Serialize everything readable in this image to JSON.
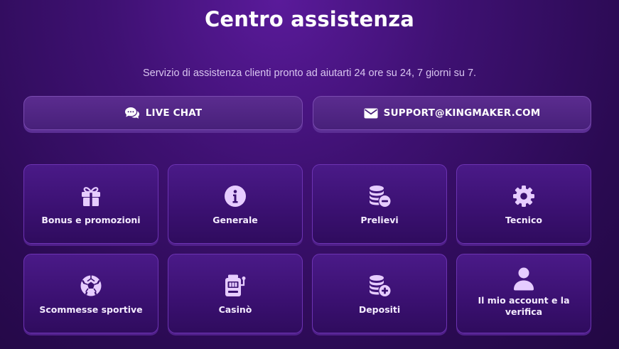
{
  "header": {
    "title": "Centro assistenza",
    "subtitle": "Servizio di assistenza clienti pronto ad aiutarti 24 ore su 24, 7 giorni su 7."
  },
  "contact": {
    "chat_label": "LIVE CHAT",
    "chat_icon": "chat-bubbles-icon",
    "email_label": "SUPPORT@KINGMAKER.COM",
    "email_icon": "envelope-icon"
  },
  "categories": [
    {
      "label": "Bonus e promozioni",
      "icon": "gift-icon"
    },
    {
      "label": "Generale",
      "icon": "info-icon"
    },
    {
      "label": "Prelievi",
      "icon": "coins-minus-icon"
    },
    {
      "label": "Tecnico",
      "icon": "gear-icon"
    },
    {
      "label": "Scommesse sportive",
      "icon": "soccer-ball-icon"
    },
    {
      "label": "Casinò",
      "icon": "slot-machine-icon"
    },
    {
      "label": "Depositi",
      "icon": "coins-plus-icon"
    },
    {
      "label": "Il mio account e la verifica",
      "icon": "user-icon"
    }
  ],
  "colors": {
    "background": "#3f1173",
    "card": "#3a1070",
    "icon": "#e6ccff",
    "border": "#6d33b3"
  }
}
